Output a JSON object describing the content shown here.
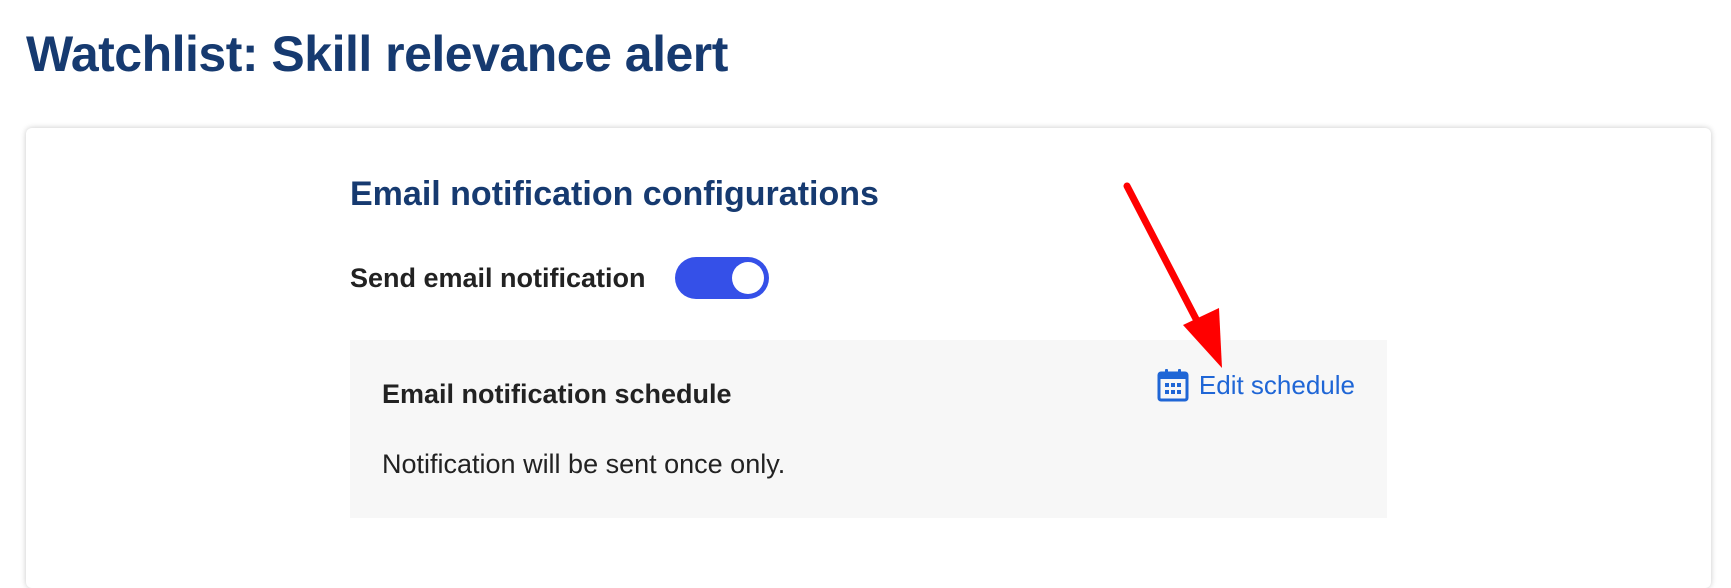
{
  "page": {
    "title": "Watchlist: Skill relevance alert"
  },
  "email_config": {
    "heading": "Email notification configurations",
    "send_toggle": {
      "label": "Send email notification",
      "checked": true
    },
    "schedule": {
      "title": "Email notification schedule",
      "description": "Notification will be sent once only.",
      "edit_label": "Edit schedule",
      "edit_icon": "calendar-icon"
    }
  },
  "colors": {
    "heading": "#163a70",
    "toggle_on": "#3550e8",
    "link": "#1f66d6",
    "annotation_arrow": "#ff0000"
  }
}
